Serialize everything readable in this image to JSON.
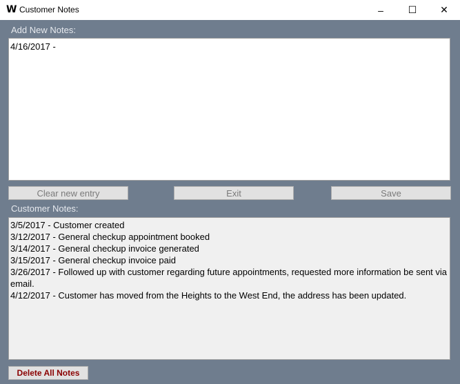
{
  "window": {
    "title": "Customer Notes",
    "icon": "W",
    "minimize": "–",
    "maximize": "☐",
    "close": "✕"
  },
  "new_notes": {
    "label": "Add New Notes:",
    "value": "4/16/2017 -"
  },
  "buttons": {
    "clear": "Clear new entry",
    "exit": "Exit",
    "save": "Save",
    "delete_all": "Delete All Notes"
  },
  "customer_notes": {
    "label": "Customer Notes:",
    "lines": [
      "3/5/2017 - Customer created",
      "3/12/2017 - General checkup appointment booked",
      "3/14/2017 - General checkup invoice generated",
      "3/15/2017 - General checkup invoice paid",
      "3/26/2017 - Followed up with customer regarding future appointments, requested more information be sent via email.",
      "4/12/2017 - Customer has moved from the Heights to the West End, the address has been updated."
    ]
  },
  "colors": {
    "background": "#6f7d8e",
    "delete_text": "#8b0000"
  }
}
